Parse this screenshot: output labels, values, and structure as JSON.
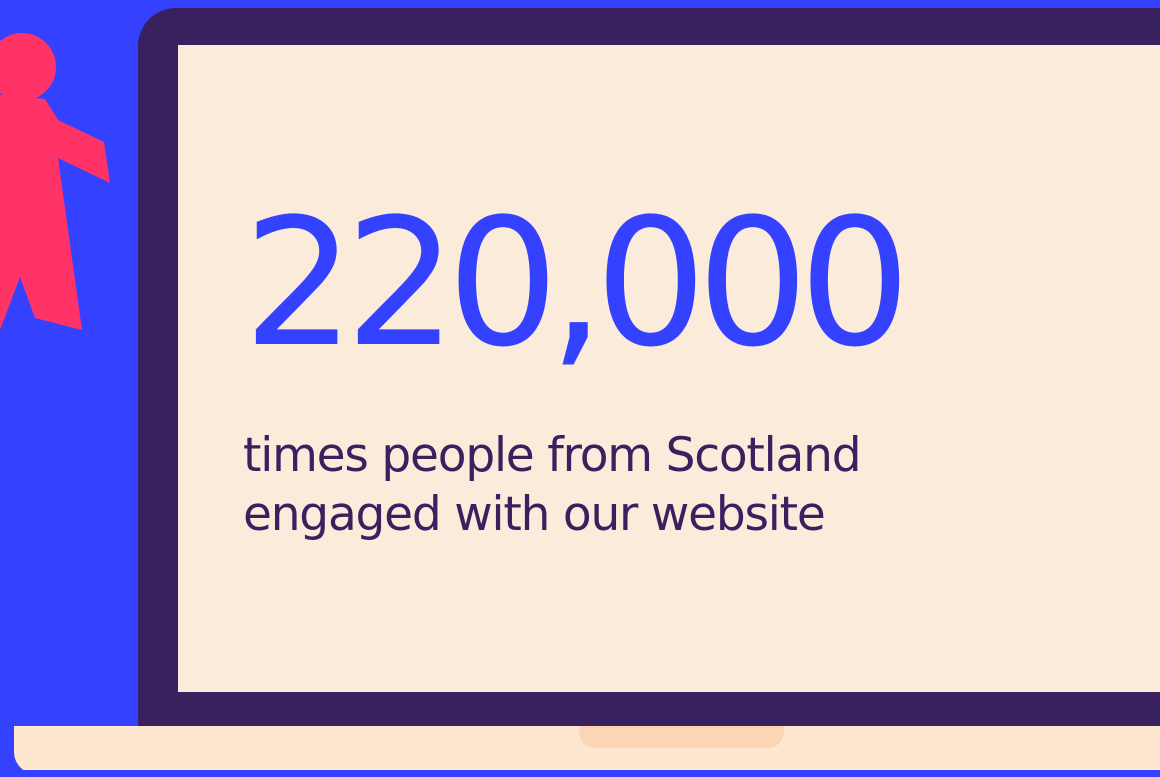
{
  "content": {
    "stat_number": "220,000",
    "stat_caption": "times people from Scotland\nengaged with our website"
  },
  "illustration": {
    "figure_icon": "person-waving-icon",
    "device_icon": "laptop-icon"
  },
  "colors": {
    "background_blue": "#3442ff",
    "laptop_purple": "#39215f",
    "screen_cream": "#fbebdb",
    "base_peach": "#fde7d0",
    "notch_peach": "#fcd6b4",
    "figure_red": "#ff3366",
    "number_blue": "#3442ff"
  }
}
